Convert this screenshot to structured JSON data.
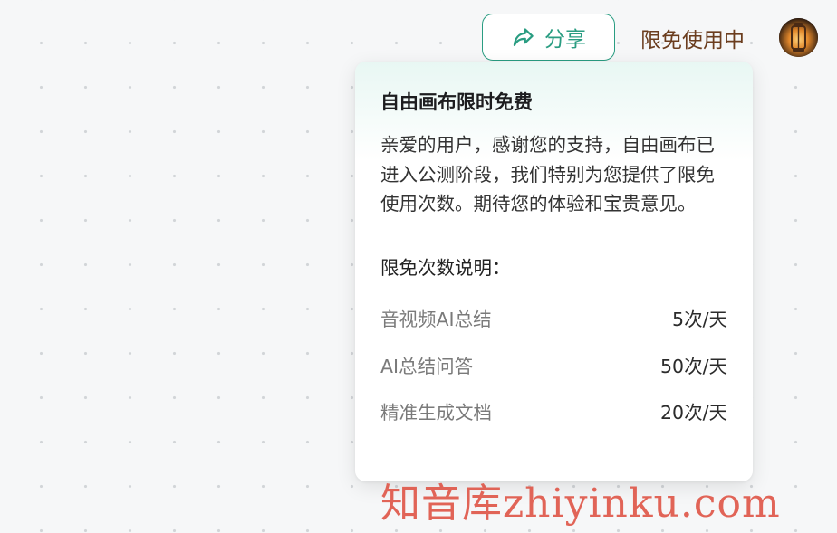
{
  "header": {
    "share_label": "分享",
    "free_status": "限免使用中"
  },
  "popover": {
    "title": "自由画布限时免费",
    "body": "亲爱的用户，感谢您的支持，自由画布已进入公测阶段，我们特别为您提供了限免使用次数。期待您的体验和宝贵意见。",
    "limits_heading": "限免次数说明：",
    "limits": [
      {
        "name": "音视频AI总结",
        "value": "5次/天"
      },
      {
        "name": "AI总结问答",
        "value": "50次/天"
      },
      {
        "name": "精准生成文档",
        "value": "20次/天"
      }
    ]
  },
  "watermark": "知音库zhiyinku.com",
  "colors": {
    "accent": "#2a9d82",
    "status_text": "#6b3d1e",
    "watermark": "#e0584a"
  }
}
